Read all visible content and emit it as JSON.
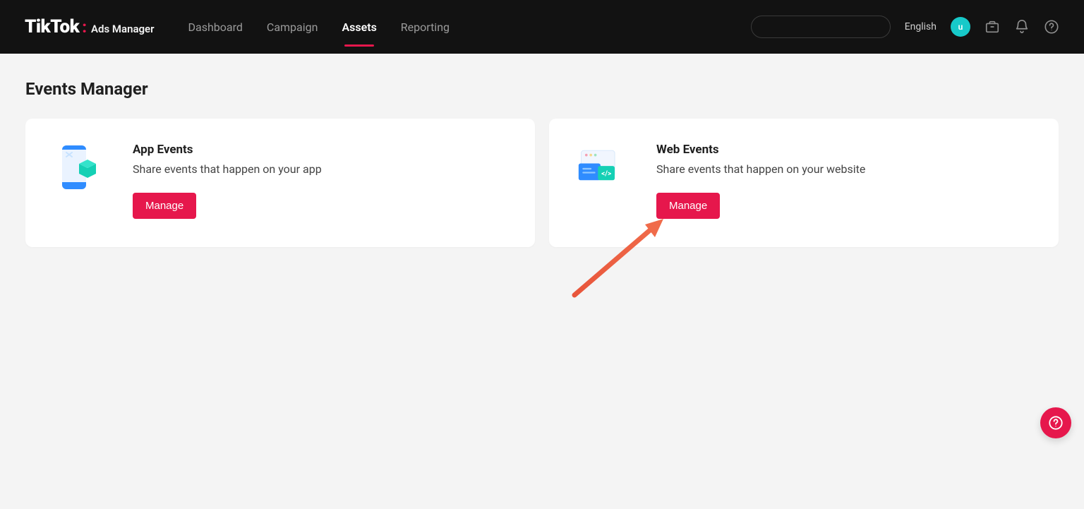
{
  "header": {
    "brand_main": "TikTok",
    "brand_sub": "Ads Manager",
    "nav": [
      {
        "label": "Dashboard",
        "active": false
      },
      {
        "label": "Campaign",
        "active": false
      },
      {
        "label": "Assets",
        "active": true
      },
      {
        "label": "Reporting",
        "active": false
      }
    ],
    "language": "English",
    "avatar_initial": "u"
  },
  "page": {
    "title": "Events Manager",
    "cards": [
      {
        "title": "App Events",
        "description": "Share events that happen on your app",
        "button": "Manage"
      },
      {
        "title": "Web Events",
        "description": "Share events that happen on your website",
        "button": "Manage"
      }
    ]
  },
  "colors": {
    "primary": "#E6174C",
    "accent": "#17C9C9",
    "header_bg": "#121212",
    "page_bg": "#F4F4F4"
  }
}
